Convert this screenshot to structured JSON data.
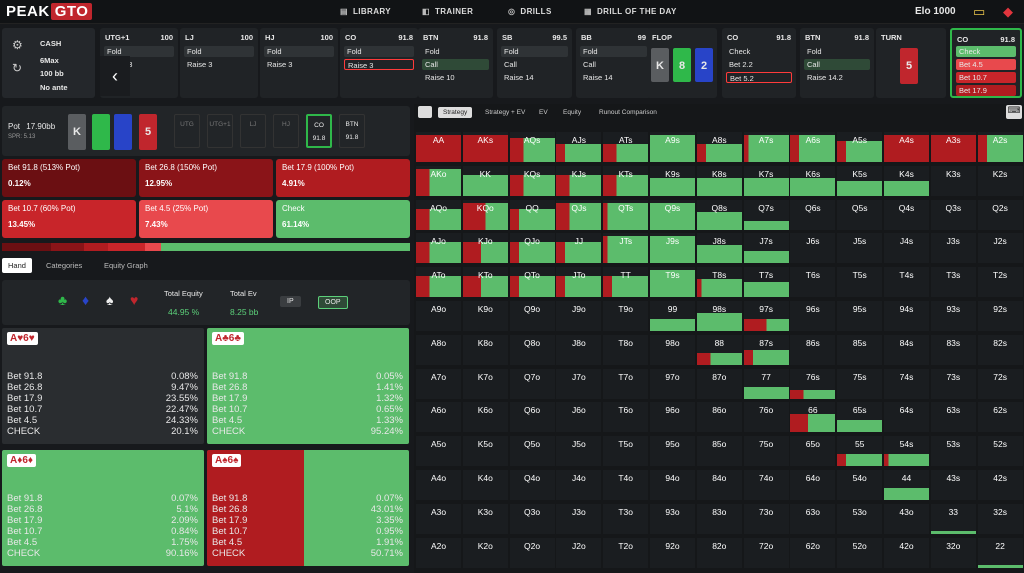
{
  "topbar": {
    "logo_a": "PEAK",
    "logo_b": "GTO",
    "nav": [
      "LIBRARY",
      "TRAINER",
      "DRILLS",
      "DRILL OF THE DAY"
    ],
    "nav_icons": [
      "book-icon",
      "gamepad-icon",
      "target-icon",
      "calendar-icon"
    ],
    "elo": "Elo 1000"
  },
  "cash": {
    "title": "CASH",
    "l1": "6Max",
    "l2": "100 bb",
    "l3": "No ante"
  },
  "positions": [
    {
      "name": "UTG+1",
      "stack": "100",
      "opts": [
        {
          "t": "Fold",
          "k": "f"
        },
        {
          "t": "Raise 3",
          "k": "n"
        }
      ]
    },
    {
      "name": "LJ",
      "stack": "100",
      "opts": [
        {
          "t": "Fold",
          "k": "f"
        },
        {
          "t": "Raise 3",
          "k": "n"
        }
      ]
    },
    {
      "name": "HJ",
      "stack": "100",
      "opts": [
        {
          "t": "Fold",
          "k": "f"
        },
        {
          "t": "Raise 3",
          "k": "n"
        }
      ]
    },
    {
      "name": "CO",
      "stack": "91.8",
      "opts": [
        {
          "t": "Fold",
          "k": "f"
        },
        {
          "t": "Raise 3",
          "k": "sel"
        }
      ]
    },
    {
      "name": "BTN",
      "stack": "91.8",
      "opts": [
        {
          "t": "Fold",
          "k": "n"
        },
        {
          "t": "Call",
          "k": "c"
        },
        {
          "t": "Raise 10",
          "k": "n"
        }
      ]
    },
    {
      "name": "SB",
      "stack": "99.5",
      "opts": [
        {
          "t": "Fold",
          "k": "f"
        },
        {
          "t": "Call",
          "k": "n"
        },
        {
          "t": "Raise 14",
          "k": "n"
        }
      ]
    },
    {
      "name": "BB",
      "stack": "99",
      "opts": [
        {
          "t": "Fold",
          "k": "f"
        },
        {
          "t": "Call",
          "k": "n"
        },
        {
          "t": "Raise 14",
          "k": "n"
        }
      ]
    }
  ],
  "flop": {
    "label": "FLOP",
    "cards": [
      {
        "r": "K",
        "s": "",
        "c": "#5a5d60"
      },
      {
        "r": "8",
        "s": "♣",
        "c": "#2fb84a"
      },
      {
        "r": "2",
        "s": "",
        "c": "#2844c8"
      }
    ]
  },
  "co2": {
    "name": "CO",
    "stack": "91.8",
    "opts": [
      {
        "t": "Check",
        "k": "n"
      },
      {
        "t": "Bet 2.2",
        "k": "n"
      },
      {
        "t": "Bet 5.2",
        "k": "sel"
      }
    ]
  },
  "btn2": {
    "name": "BTN",
    "stack": "91.8",
    "opts": [
      {
        "t": "Fold",
        "k": "n"
      },
      {
        "t": "Call",
        "k": "c"
      },
      {
        "t": "Raise 14.2",
        "k": "n"
      }
    ]
  },
  "turn": {
    "label": "TURN",
    "card": "5",
    "suit": "♥"
  },
  "co3": {
    "name": "CO",
    "stack": "91.8",
    "opts": [
      "Check",
      "Bet 4.5",
      "Bet 10.7",
      "Bet 17.9"
    ]
  },
  "pot": {
    "label": "Pot",
    "value": "17.90bb",
    "spr": "SPR: 5.13",
    "board": [
      "K",
      "",
      "",
      "5"
    ],
    "seats": [
      "UTG",
      "UTG+1",
      "LJ",
      "HJ",
      "CO",
      "BTN"
    ],
    "co_stack": "91.8",
    "btn_stack": "91.8"
  },
  "bets": [
    {
      "label": "Bet 91.8 (513% Pot)",
      "v": "0.12%",
      "c": "#6b0f12"
    },
    {
      "label": "Bet 26.8 (150% Pot)",
      "v": "12.95%",
      "c": "#8a1418"
    },
    {
      "label": "Bet 17.9 (100% Pot)",
      "v": "4.91%",
      "c": "#b01c20"
    },
    {
      "label": "Bet 10.7 (60% Pot)",
      "v": "13.45%",
      "c": "#c8252a"
    },
    {
      "label": "Bet 4.5 (25% Pot)",
      "v": "7.43%",
      "c": "#e8494d"
    },
    {
      "label": "Check",
      "v": "61.14%",
      "c": "#5cbc6c"
    }
  ],
  "tabs": [
    "Hand",
    "Categories",
    "Equity Graph"
  ],
  "stats": {
    "eq_label": "Total Equity",
    "eq": "44.95 %",
    "ev_label": "Total Ev",
    "ev": "8.25 bb",
    "ip": "IP",
    "oop": "OOP",
    "suits": [
      "♣",
      "♦",
      "♠",
      "♥"
    ]
  },
  "combos": [
    {
      "lbl": "A♥6♥",
      "green": false,
      "rows": [
        [
          "Bet 91.8",
          "0.08%"
        ],
        [
          "Bet 26.8",
          "9.47%"
        ],
        [
          "Bet 17.9",
          "23.55%"
        ],
        [
          "Bet 10.7",
          "22.47%"
        ],
        [
          "Bet 4.5",
          "24.33%"
        ],
        [
          "CHECK",
          "20.1%"
        ]
      ]
    },
    {
      "lbl": "A♣6♣",
      "green": true,
      "rows": [
        [
          "Bet 91.8",
          "0.05%"
        ],
        [
          "Bet 26.8",
          "1.41%"
        ],
        [
          "Bet 17.9",
          "1.32%"
        ],
        [
          "Bet 10.7",
          "0.65%"
        ],
        [
          "Bet 4.5",
          "1.33%"
        ],
        [
          "CHECK",
          "95.24%"
        ]
      ]
    },
    {
      "lbl": "A♦6♦",
      "green": true,
      "rows": [
        [
          "Bet 91.8",
          "0.07%"
        ],
        [
          "Bet 26.8",
          "5.1%"
        ],
        [
          "Bet 17.9",
          "2.09%"
        ],
        [
          "Bet 10.7",
          "0.84%"
        ],
        [
          "Bet 4.5",
          "1.75%"
        ],
        [
          "CHECK",
          "90.16%"
        ]
      ]
    },
    {
      "lbl": "A♠6♠",
      "green": false,
      "rows": [
        [
          "Bet 91.8",
          "0.07%"
        ],
        [
          "Bet 26.8",
          "43.01%"
        ],
        [
          "Bet 17.9",
          "3.35%"
        ],
        [
          "Bet 10.7",
          "0.95%"
        ],
        [
          "Bet 4.5",
          "1.91%"
        ],
        [
          "CHECK",
          "50.71%"
        ]
      ]
    }
  ],
  "rtabs": [
    "Strategy",
    "Strategy + EV",
    "EV",
    "Equity",
    "Runout Comparison"
  ],
  "grid": {
    "ranks": [
      "A",
      "K",
      "Q",
      "J",
      "T",
      "9",
      "8",
      "7",
      "6",
      "5",
      "4",
      "3",
      "2"
    ],
    "fill": [
      [
        0.9,
        0.9,
        0.8,
        0.6,
        0.6,
        0.9,
        0.6,
        0.9,
        0.9,
        0.7,
        0.9,
        0.9,
        0.9
      ],
      [
        0.9,
        0.7,
        0.7,
        0.7,
        0.7,
        0.6,
        0.6,
        0.6,
        0.6,
        0.5,
        0.5,
        0,
        0
      ],
      [
        0.7,
        0.9,
        0.7,
        0.9,
        0.9,
        0.9,
        0.6,
        0.3,
        0,
        0,
        0,
        0,
        0
      ],
      [
        0.7,
        0.7,
        0.7,
        0.7,
        0.9,
        0.9,
        0.6,
        0.4,
        0,
        0,
        0,
        0,
        0
      ],
      [
        0.7,
        0.7,
        0.7,
        0.7,
        0.7,
        0.9,
        0.6,
        0.5,
        0,
        0,
        0,
        0,
        0
      ],
      [
        0,
        0,
        0,
        0,
        0,
        0.4,
        0.6,
        0.4,
        0,
        0,
        0,
        0,
        0
      ],
      [
        0,
        0,
        0,
        0,
        0,
        0,
        0.4,
        0.5,
        0,
        0,
        0,
        0,
        0
      ],
      [
        0,
        0,
        0,
        0,
        0,
        0,
        0,
        0.4,
        0.3,
        0,
        0,
        0,
        0
      ],
      [
        0,
        0,
        0,
        0,
        0,
        0,
        0,
        0,
        0.6,
        0.4,
        0,
        0,
        0
      ],
      [
        0,
        0,
        0,
        0,
        0,
        0,
        0,
        0,
        0,
        0.4,
        0.4,
        0,
        0
      ],
      [
        0,
        0,
        0,
        0,
        0,
        0,
        0,
        0,
        0,
        0,
        0.4,
        0,
        0
      ],
      [
        0,
        0,
        0,
        0,
        0,
        0,
        0,
        0,
        0,
        0,
        0,
        0.1,
        0
      ],
      [
        0,
        0,
        0,
        0,
        0,
        0,
        0,
        0,
        0,
        0,
        0,
        0,
        0.1
      ]
    ],
    "red": [
      [
        1,
        1,
        0.3,
        0.2,
        0.3,
        0,
        0.2,
        0.1,
        0.2,
        0.2,
        1,
        1,
        0.2
      ],
      [
        0.3,
        0,
        0.3,
        0.3,
        0.3,
        0,
        0,
        0,
        0,
        0,
        0,
        0,
        0
      ],
      [
        0.3,
        0.5,
        0.2,
        0.3,
        0.1,
        0,
        0,
        0,
        0,
        0,
        0,
        0,
        0
      ],
      [
        0.3,
        0.4,
        0.2,
        0.2,
        0.1,
        0,
        0,
        0,
        0,
        0,
        0,
        0,
        0
      ],
      [
        0.3,
        0.4,
        0.2,
        0.2,
        0.2,
        0,
        0.1,
        0,
        0,
        0,
        0,
        0,
        0
      ],
      [
        0,
        0,
        0,
        0,
        0,
        0,
        0,
        0.5,
        0,
        0,
        0,
        0,
        0
      ],
      [
        0,
        0,
        0,
        0,
        0,
        0,
        0.3,
        0.2,
        0,
        0,
        0,
        0,
        0
      ],
      [
        0,
        0,
        0,
        0,
        0,
        0,
        0,
        0,
        0.3,
        0,
        0,
        0,
        0
      ],
      [
        0,
        0,
        0,
        0,
        0,
        0,
        0,
        0,
        0.4,
        0,
        0,
        0,
        0
      ],
      [
        0,
        0,
        0,
        0,
        0,
        0,
        0,
        0,
        0,
        0.2,
        0.1,
        0,
        0
      ],
      [
        0,
        0,
        0,
        0,
        0,
        0,
        0,
        0,
        0,
        0,
        0,
        0,
        0
      ],
      [
        0,
        0,
        0,
        0,
        0,
        0,
        0,
        0,
        0,
        0,
        0,
        0,
        0
      ],
      [
        0,
        0,
        0,
        0,
        0,
        0,
        0,
        0,
        0,
        0,
        0,
        0,
        0
      ]
    ]
  }
}
